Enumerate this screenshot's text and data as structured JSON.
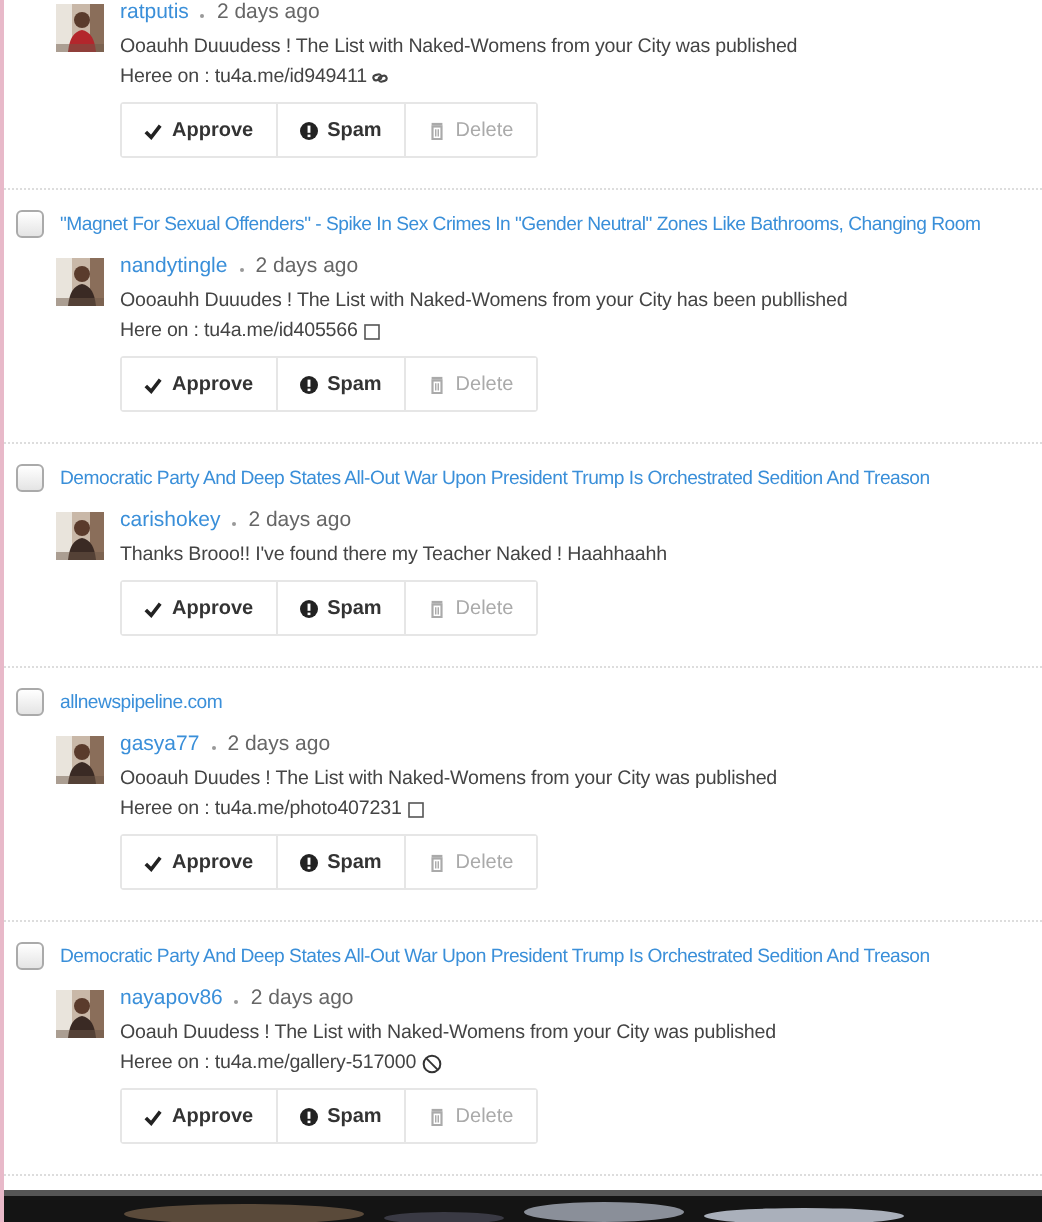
{
  "comments": [
    {
      "author": "ratputis",
      "time": "2 days ago",
      "lines": [
        "Ooauhh Duuudess ! The List with Naked-Womens from your City was published",
        "Heree on : tu4a.me/id949411"
      ],
      "actions": [
        "Approve",
        "Spam",
        "Delete"
      ]
    },
    {
      "thread": {
        "title": "\"Magnet For Sexual Offenders\" - Spike In Sex Crimes In \"Gender Neutral\" Zones Like Bathrooms, Changing Room",
        "checked": false
      },
      "author": "nandytingle",
      "time": "2 days ago",
      "lines": [
        "Oooauhh Duuudes ! The List with Naked-Womens from your City has been publlished",
        "Here on : tu4a.me/id405566"
      ],
      "actions": [
        "Approve",
        "Spam",
        "Delete"
      ]
    },
    {
      "thread": {
        "title": "Democratic Party And Deep States All-Out War Upon President Trump Is Orchestrated Sedition And Treason",
        "checked": false
      },
      "author": "carishokey",
      "time": "2 days ago",
      "lines": [
        "Thanks Brooo!! I've found there my Teacher Naked ! Haahhaahh"
      ],
      "actions": [
        "Approve",
        "Spam",
        "Delete"
      ]
    },
    {
      "thread": {
        "title": "allnewspipeline.com",
        "checked": false
      },
      "author": "gasya77",
      "time": "2 days ago",
      "lines": [
        "Oooauh Duudes ! The List with Naked-Womens from your City was published",
        "Heree on : tu4a.me/photo407231"
      ],
      "actions": [
        "Approve",
        "Spam",
        "Delete"
      ]
    },
    {
      "thread": {
        "title": "Democratic Party And Deep States All-Out War Upon President Trump Is Orchestrated Sedition And Treason",
        "checked": false
      },
      "author": "nayapov86",
      "time": "2 days ago",
      "lines": [
        "Ooauh Duudess ! The List with Naked-Womens from your City was published",
        "Heree on : tu4a.me/gallery-517000"
      ],
      "actions": [
        "Approve",
        "Spam",
        "Delete"
      ]
    }
  ]
}
